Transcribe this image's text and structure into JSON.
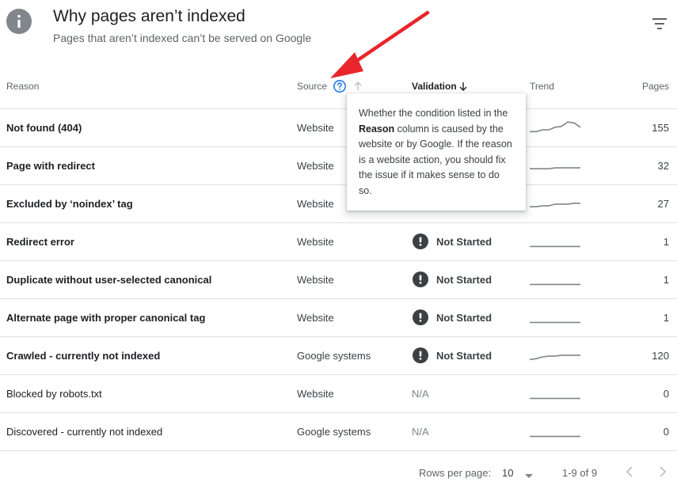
{
  "header": {
    "title": "Why pages aren’t indexed",
    "subtitle": "Pages that aren’t indexed can’t be served on Google",
    "icon": "info-icon",
    "filter_icon": "filter-icon"
  },
  "columns": {
    "reason": "Reason",
    "source": "Source",
    "validation": "Validation",
    "trend": "Trend",
    "pages": "Pages"
  },
  "tooltip": {
    "before": "Whether the condition listed in the ",
    "bold": "Reason",
    "after": " column is caused by the website or by Google. If the reason is a website action, you should fix the issue if it makes sense to do so."
  },
  "rows": [
    {
      "reason": "Not found (404)",
      "source": "Website",
      "validation": "",
      "pages": "155",
      "trend": [
        0.35,
        0.35,
        0.45,
        0.45,
        0.6,
        0.65,
        0.9,
        0.85,
        0.6
      ]
    },
    {
      "reason": "Page with redirect",
      "source": "Website",
      "validation": "",
      "pages": "32",
      "trend": [
        0.4,
        0.4,
        0.4,
        0.4,
        0.45,
        0.45,
        0.45,
        0.45,
        0.45
      ]
    },
    {
      "reason": "Excluded by ‘noindex’ tag",
      "source": "Website",
      "validation": "",
      "pages": "27",
      "trend": [
        0.4,
        0.4,
        0.45,
        0.45,
        0.55,
        0.55,
        0.55,
        0.6,
        0.6
      ]
    },
    {
      "reason": "Redirect error",
      "source": "Website",
      "validation": "Not Started",
      "pages": "1",
      "trend": [
        0.3,
        0.3,
        0.3,
        0.3,
        0.3,
        0.3,
        0.3,
        0.3,
        0.3
      ]
    },
    {
      "reason": "Duplicate without user-selected canonical",
      "source": "Website",
      "validation": "Not Started",
      "pages": "1",
      "trend": [
        0.3,
        0.3,
        0.3,
        0.3,
        0.3,
        0.3,
        0.3,
        0.3,
        0.3
      ]
    },
    {
      "reason": "Alternate page with proper canonical tag",
      "source": "Website",
      "validation": "Not Started",
      "pages": "1",
      "trend": [
        0.3,
        0.3,
        0.3,
        0.3,
        0.3,
        0.3,
        0.3,
        0.3,
        0.3
      ]
    },
    {
      "reason": "Crawled - currently not indexed",
      "source": "Google systems",
      "validation": "Not Started",
      "pages": "120",
      "trend": [
        0.35,
        0.4,
        0.5,
        0.55,
        0.55,
        0.6,
        0.6,
        0.6,
        0.6
      ]
    },
    {
      "reason": "Blocked by robots.txt",
      "source": "Website",
      "validation": "N/A",
      "pages": "0",
      "trend": [
        0.3,
        0.3,
        0.3,
        0.3,
        0.3,
        0.3,
        0.3,
        0.3,
        0.3
      ]
    },
    {
      "reason": "Discovered - currently not indexed",
      "source": "Google systems",
      "validation": "N/A",
      "pages": "0",
      "trend": [
        0.3,
        0.3,
        0.3,
        0.3,
        0.3,
        0.3,
        0.3,
        0.3,
        0.3
      ]
    }
  ],
  "footer": {
    "rows_per_page_label": "Rows per page:",
    "rows_per_page_value": "10",
    "range": "1-9 of 9"
  },
  "colors": {
    "annotation_arrow": "#e8262b",
    "help_icon": "#1a73e8",
    "status_icon": "#3c4043"
  }
}
